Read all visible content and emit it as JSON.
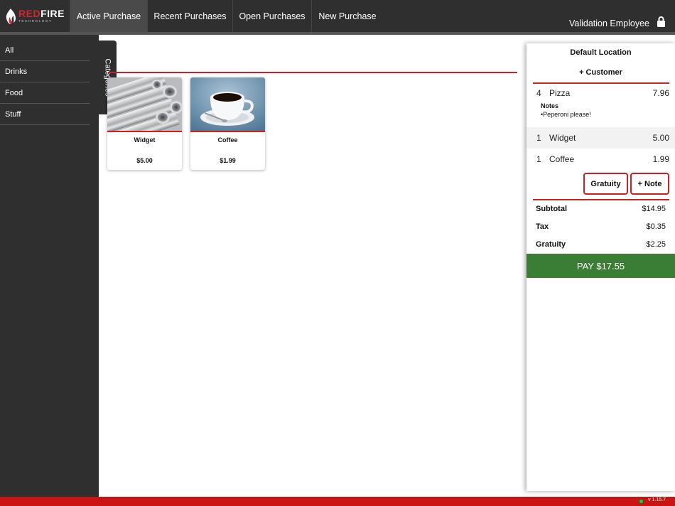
{
  "brand": {
    "name_red": "RED",
    "name_white": "FIRE",
    "tagline": "TECHNOLOGY"
  },
  "nav": {
    "tabs": [
      {
        "label": "Active Purchase",
        "active": true
      },
      {
        "label": "Recent Purchases",
        "active": false
      },
      {
        "label": "Open Purchases",
        "active": false
      },
      {
        "label": "New Purchase",
        "active": false
      }
    ],
    "employee": "Validation Employee",
    "lock_icon": "lock-icon"
  },
  "sidebar": {
    "toggle_label": "Categories",
    "items": [
      {
        "label": "All"
      },
      {
        "label": "Drinks"
      },
      {
        "label": "Food"
      },
      {
        "label": "Stuff"
      }
    ]
  },
  "products": [
    {
      "name": "Widget",
      "price": "$5.00",
      "image": "steel-pipes-image"
    },
    {
      "name": "Coffee",
      "price": "$1.99",
      "image": "coffee-cup-image"
    }
  ],
  "order": {
    "location": "Default Location",
    "add_customer": "+ Customer",
    "items": [
      {
        "qty": "4",
        "name": "Pizza",
        "price": "7.96",
        "notes_title": "Notes",
        "notes": "•Peperoni please!"
      },
      {
        "qty": "1",
        "name": "Widget",
        "price": "5.00"
      },
      {
        "qty": "1",
        "name": "Coffee",
        "price": "1.99"
      }
    ],
    "gratuity_button": "Gratuity",
    "note_button": "+ Note",
    "summary": {
      "subtotal_label": "Subtotal",
      "subtotal": "$14.95",
      "tax_label": "Tax",
      "tax": "$0.35",
      "gratuity_label": "Gratuity",
      "gratuity": "$2.25"
    },
    "pay_label": "PAY $17.55"
  },
  "footer": {
    "version": "v 1.15.7"
  },
  "colors": {
    "accent_red": "#cc1f26",
    "pay_green": "#3a7d35",
    "dark": "#2f2f2f"
  }
}
